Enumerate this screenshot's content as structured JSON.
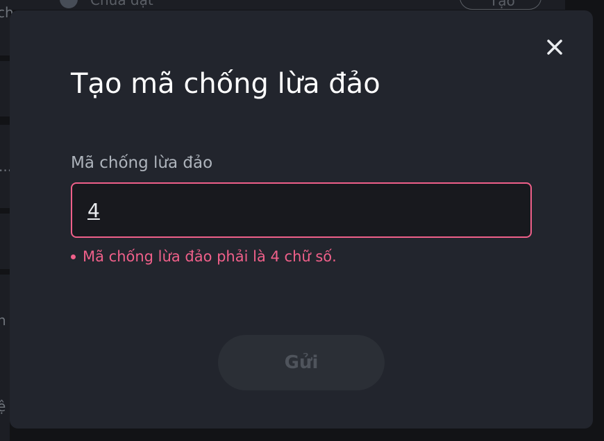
{
  "background": {
    "status_text": "Chưa đặt",
    "action_button_label": "Tạo",
    "side_fragments": [
      "ch",
      "...",
      "h",
      "ệ"
    ]
  },
  "modal": {
    "title": "Tạo mã chống lừa đảo",
    "close_icon": "close-icon",
    "field_label": "Mã chống lừa đảo",
    "input_value": "4",
    "error_message": "Mã chống lừa đảo phải là 4 chữ số.",
    "submit_label": "Gửi"
  },
  "colors": {
    "modal_bg": "#22252d",
    "page_bg": "#121316",
    "error": "#f0608a",
    "title_text": "#ffffff",
    "label_text": "#aeb4bc",
    "button_disabled_bg": "#2b2f36",
    "button_disabled_text": "#4f545c"
  }
}
